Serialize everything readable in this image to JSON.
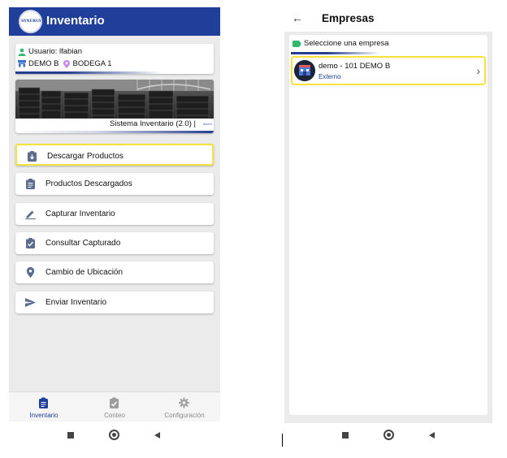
{
  "colors": {
    "primary": "#1f3f9a",
    "highlight": "#f6e23c",
    "nav_inactive": "#9e9e9e"
  },
  "left": {
    "app_title": "Inventario",
    "logo_text": "SYNERGY",
    "user_label": "Usuario: lfabian",
    "company": "DEMO B",
    "warehouse": "BODEGA 1",
    "system_name": "Sistema Inventario (2.0) |",
    "small_logo_text": "dinero",
    "menu": [
      {
        "label": "Descargar Productos",
        "icon": "download-clipboard-icon"
      },
      {
        "label": "Productos Descargados",
        "icon": "clipboard-list-icon"
      },
      {
        "label": "Capturar Inventario",
        "icon": "edit-pencil-icon"
      },
      {
        "label": "Consultar Capturado",
        "icon": "clipboard-check-icon"
      },
      {
        "label": "Cambio de Ubicación",
        "icon": "location-pin-icon"
      },
      {
        "label": "Enviar Inventario",
        "icon": "send-icon"
      }
    ],
    "nav": [
      {
        "label": "Inventario",
        "icon": "clipboard-icon",
        "active": true
      },
      {
        "label": "Conteo",
        "icon": "clipboard-check-icon",
        "active": false
      },
      {
        "label": "Configuración",
        "icon": "gear-icon",
        "active": false
      }
    ]
  },
  "right": {
    "title": "Empresas",
    "select_label": "Seleccione una empresa",
    "companies": [
      {
        "name": "demo - 101 DEMO B",
        "type": "Externo"
      }
    ]
  }
}
